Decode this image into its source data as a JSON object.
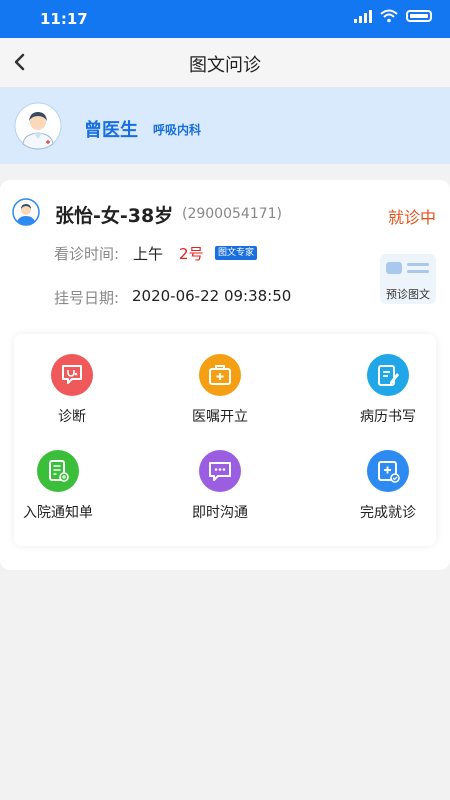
{
  "status_bar": {
    "time": "11:17"
  },
  "nav": {
    "title": "图文问诊"
  },
  "doctor": {
    "name": "曾医生",
    "department": "呼吸内科"
  },
  "patient": {
    "name_line": "张怡-女-38岁",
    "id": "(2900054171)",
    "status": "就诊中",
    "visit_time_label": "看诊时间:",
    "visit_period": "上午",
    "visit_number": "2号",
    "badge": "图文专家",
    "register_date_label": "挂号日期:",
    "register_date": "2020-06-22 09:38:50",
    "pre_consult": "预诊图文"
  },
  "actions": [
    {
      "label": "诊断",
      "color": "#f0595a",
      "icon": "stethoscope-icon"
    },
    {
      "label": "医嘱开立",
      "color": "#f5a014",
      "icon": "medical-kit-icon"
    },
    {
      "label": "病历书写",
      "color": "#21a7e8",
      "icon": "clipboard-edit-icon"
    },
    {
      "label": "入院通知单",
      "color": "#3bbf3b",
      "icon": "admission-form-icon"
    },
    {
      "label": "即时沟通",
      "color": "#9c5ee0",
      "icon": "chat-icon"
    },
    {
      "label": "完成就诊",
      "color": "#2c8af0",
      "icon": "complete-visit-icon"
    }
  ],
  "colors": {
    "primary": "#1477f2",
    "accent_orange": "#e8531b",
    "banner": "#d8eafb"
  }
}
